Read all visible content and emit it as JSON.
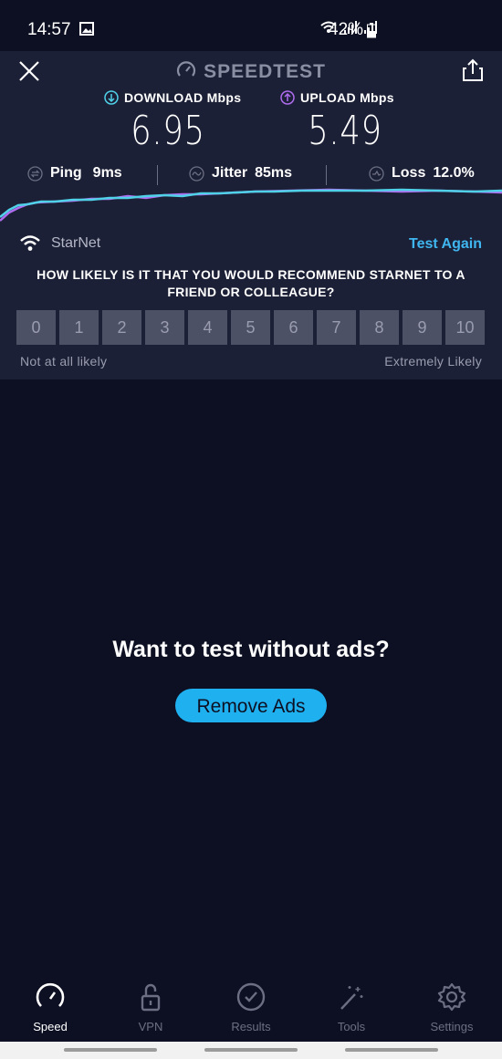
{
  "status": {
    "time": "14:57",
    "battery_pct": "42%"
  },
  "header": {
    "title": "SPEEDTEST"
  },
  "download": {
    "label": "DOWNLOAD Mbps",
    "value": "6.95",
    "color": "#4fd1e8"
  },
  "upload": {
    "label": "UPLOAD Mbps",
    "value": "5.49",
    "color": "#b06cf0"
  },
  "stats": {
    "ping": {
      "label": "Ping",
      "value": "9ms"
    },
    "jitter": {
      "label": "Jitter",
      "value": "85ms"
    },
    "loss": {
      "label": "Loss",
      "value": "12.0%"
    }
  },
  "survey": {
    "isp": "StarNet",
    "test_again": "Test Again",
    "question": "HOW LIKELY IS IT THAT YOU WOULD RECOMMEND STARNET TO A FRIEND OR COLLEAGUE?",
    "options": [
      "0",
      "1",
      "2",
      "3",
      "4",
      "5",
      "6",
      "7",
      "8",
      "9",
      "10"
    ],
    "low_label": "Not at all likely",
    "high_label": "Extremely Likely"
  },
  "ad": {
    "title": "Want to test without ads?",
    "button": "Remove Ads"
  },
  "nav": {
    "items": [
      {
        "label": "Speed",
        "icon": "speedometer-icon",
        "active": true
      },
      {
        "label": "VPN",
        "icon": "unlock-icon",
        "active": false
      },
      {
        "label": "Results",
        "icon": "check-circle-icon",
        "active": false
      },
      {
        "label": "Tools",
        "icon": "magic-wand-icon",
        "active": false
      },
      {
        "label": "Settings",
        "icon": "gear-icon",
        "active": false
      }
    ]
  },
  "colors": {
    "accent": "#1fb0f0",
    "panel": "#1c2036",
    "background": "#0d1022"
  }
}
